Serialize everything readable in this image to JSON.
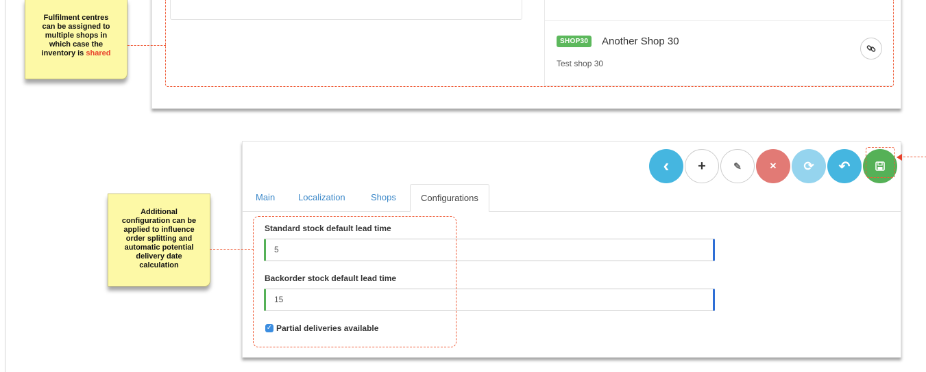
{
  "colors": {
    "annotation": "#ef5b37",
    "note_bg": "#fdf9a6",
    "success": "#5cb85c",
    "info": "#45b6e0",
    "danger": "#e27a75",
    "link": "#3a87c8"
  },
  "notes": {
    "shared_note": {
      "line1": "Fulfilment centres",
      "line2": "can be assigned to",
      "line3": "multiple shops in",
      "line4": "which case the",
      "line5_prefix": "inventory is ",
      "line5_highlight": "shared"
    },
    "config_note": {
      "line1": "Additional",
      "line2": "configuration can be",
      "line3": "applied to influence",
      "line4": "order splitting and",
      "line5": "automatic potential",
      "line6": "delivery date",
      "line7": "calculation"
    }
  },
  "shops_panel": {
    "item": {
      "badge": "SHOP30",
      "name": "Another Shop 30",
      "description": "Test shop 30",
      "link_icon": "link-icon"
    }
  },
  "toolbar": {
    "buttons": [
      {
        "name": "back",
        "icon": "chevron-left-icon",
        "glyph": "‹"
      },
      {
        "name": "add",
        "icon": "plus-icon",
        "glyph": "+"
      },
      {
        "name": "edit",
        "icon": "edit-icon",
        "glyph": "✎"
      },
      {
        "name": "cancel",
        "icon": "close-icon",
        "glyph": "✕"
      },
      {
        "name": "refresh",
        "icon": "refresh-icon",
        "glyph": "⟳"
      },
      {
        "name": "undo",
        "icon": "undo-icon",
        "glyph": "↶"
      },
      {
        "name": "save",
        "icon": "save-icon",
        "glyph": "🖫"
      }
    ]
  },
  "tabs": [
    {
      "label": "Main",
      "active": false
    },
    {
      "label": "Localization",
      "active": false
    },
    {
      "label": "Shops",
      "active": false
    },
    {
      "label": "Configurations",
      "active": true
    }
  ],
  "form": {
    "standard_lead_time": {
      "label": "Standard stock default lead time",
      "value": "5"
    },
    "backorder_lead_time": {
      "label": "Backorder stock default lead time",
      "value": "15"
    },
    "partial_deliveries": {
      "label": "Partial deliveries available",
      "checked": true
    }
  }
}
